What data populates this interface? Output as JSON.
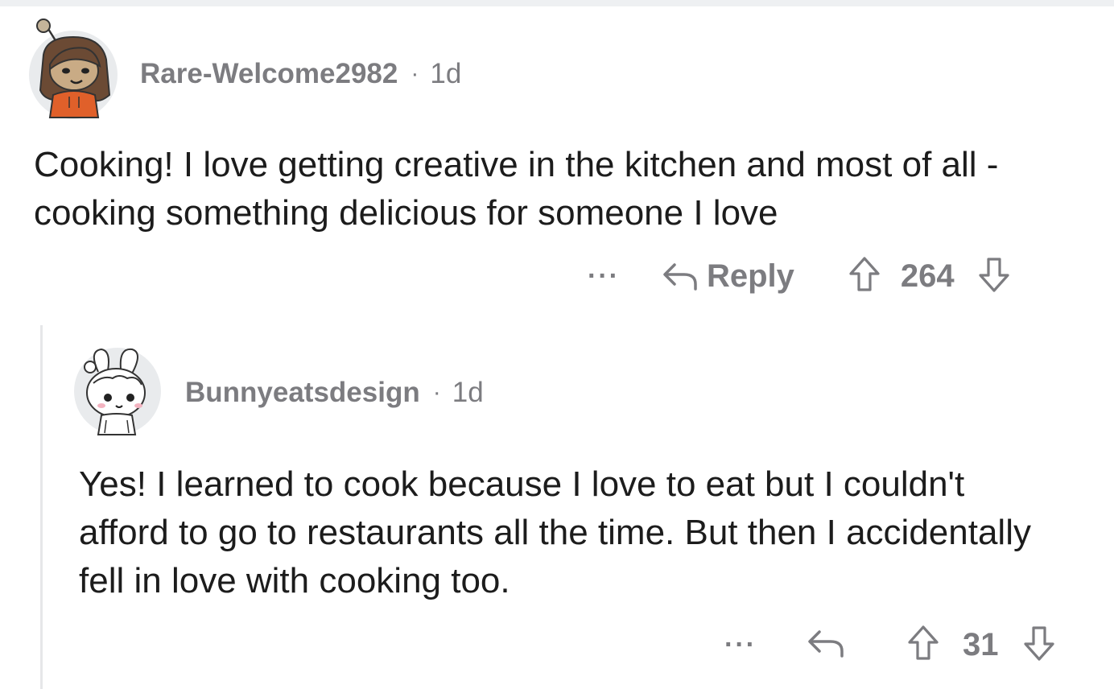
{
  "comments": [
    {
      "username": "Rare-Welcome2982",
      "separator": "·",
      "age": "1d",
      "avatar_icon": "snoo-avatar-girl-orange-hoodie-icon",
      "body": "Cooking! I love getting creative in the kitchen and most of all - cooking something delicious for someone I love",
      "more_label": "···",
      "reply_label": "Reply",
      "score": "264"
    },
    {
      "username": "Bunnyeatsdesign",
      "separator": "·",
      "age": "1d",
      "avatar_icon": "snoo-avatar-bunny-hood-icon",
      "body": "Yes! I learned to cook because I love to eat but I couldn't afford to go to restaurants all the time. But then I accidentally fell in love with cooking too.",
      "more_label": "···",
      "score": "31"
    }
  ],
  "colors": {
    "meta_text": "#7c7c80",
    "body_text": "#1c1c1c",
    "thread_line": "#e6e7e9",
    "avatar_bg": "#e9ebed",
    "hoodie_orange": "#e0602a"
  }
}
